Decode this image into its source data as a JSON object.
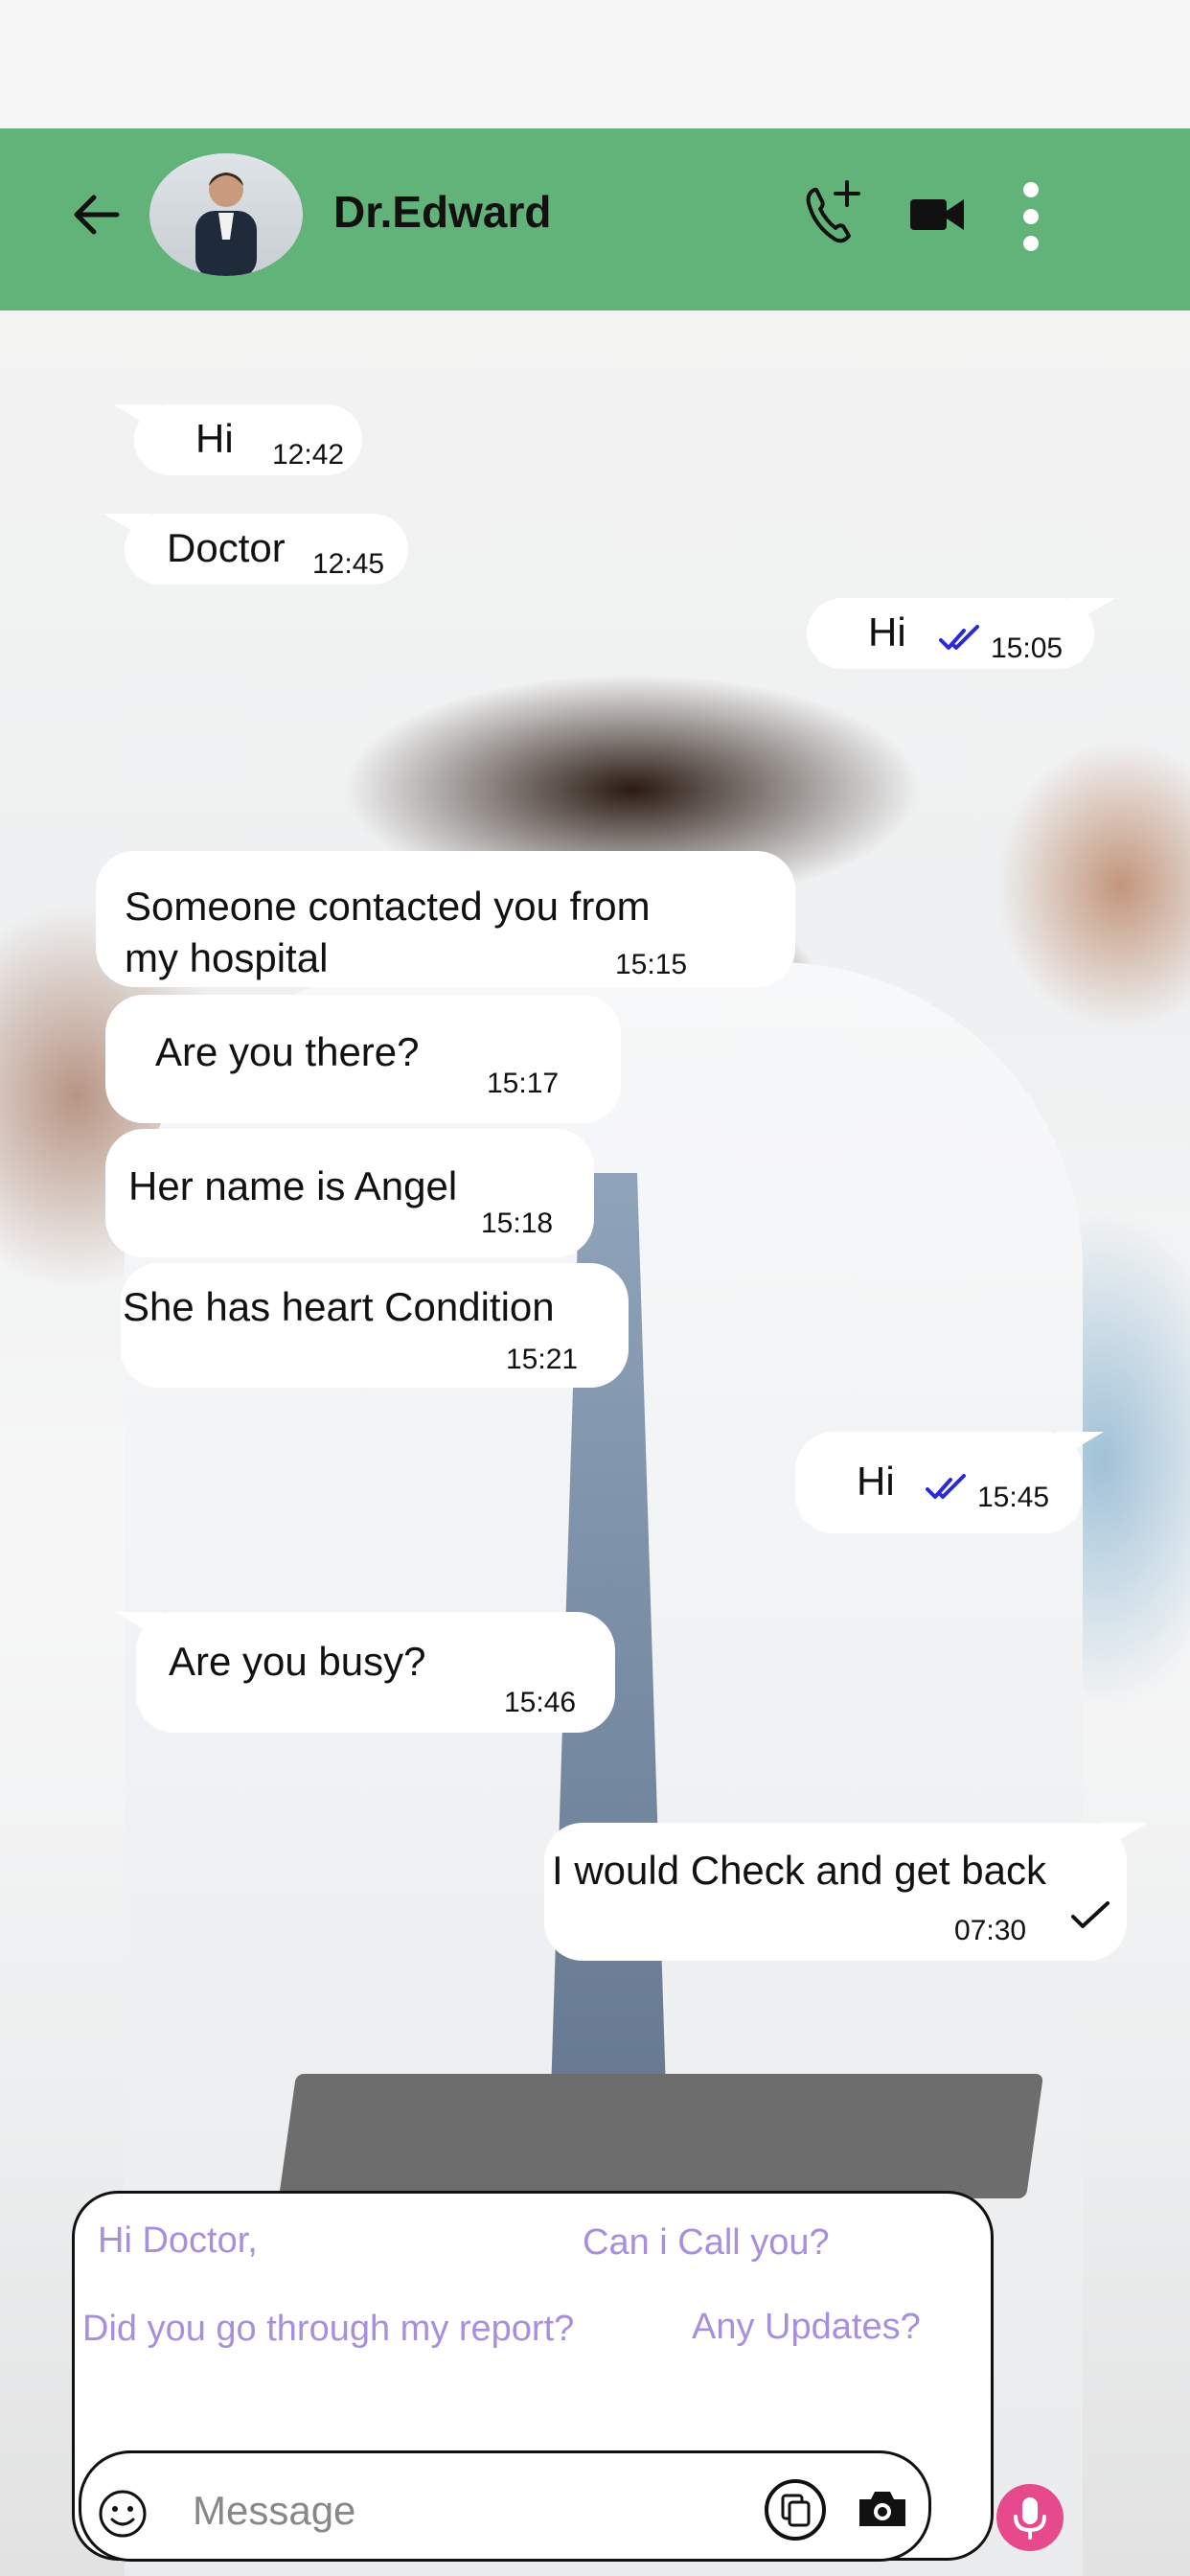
{
  "header": {
    "contact_name": "Dr.Edward",
    "bg_color": "#62b379"
  },
  "messages": [
    {
      "text": "Hi",
      "time": "12:42",
      "direction": "incoming"
    },
    {
      "text": "Doctor",
      "time": "12:45",
      "direction": "incoming"
    },
    {
      "text": "Hi",
      "time": "15:05",
      "direction": "outgoing",
      "status": "read"
    },
    {
      "text": "Someone contacted you from",
      "text2": "my hospital",
      "time": "15:15",
      "direction": "incoming"
    },
    {
      "text": "Are you there?",
      "time": "15:17",
      "direction": "incoming"
    },
    {
      "text": "Her name is Angel",
      "time": "15:18",
      "direction": "incoming"
    },
    {
      "text": "She has heart Condition",
      "time": "15:21",
      "direction": "incoming"
    },
    {
      "text": "Hi",
      "time": "15:45",
      "direction": "outgoing",
      "status": "read"
    },
    {
      "text": "Are you busy?",
      "time": "15:46",
      "direction": "incoming"
    },
    {
      "text": "I would Check and get back",
      "time": "07:30",
      "direction": "outgoing",
      "status": "sent"
    }
  ],
  "quick_replies": [
    "Hi Doctor,",
    "Can i Call you?",
    "Did you go through my report?",
    "Any Updates?"
  ],
  "composer": {
    "placeholder": "Message"
  },
  "colors": {
    "read_tick": "#2b2bd6",
    "chip_text": "#a88fde",
    "mic": "#e74a8c"
  }
}
